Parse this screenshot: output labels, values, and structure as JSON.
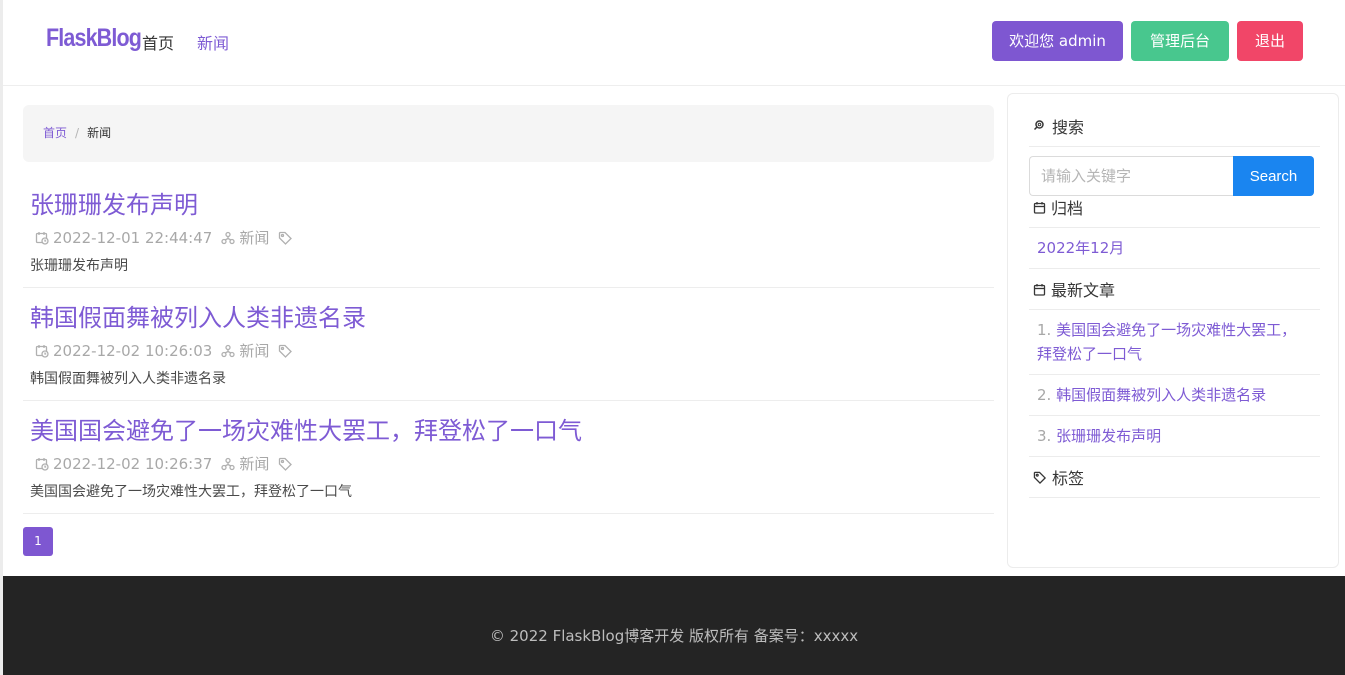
{
  "navbar": {
    "brand": "FlaskBlog",
    "links": [
      {
        "label": "首页"
      },
      {
        "label": "新闻"
      }
    ],
    "buttons": {
      "welcome": "欢迎您 admin",
      "admin": "管理后台",
      "logout": "退出"
    }
  },
  "breadcrumb": {
    "home": "首页",
    "separator": "/",
    "current": "新闻"
  },
  "posts": [
    {
      "title": "张珊珊发布声明",
      "date": "2022-12-01 22:44:47",
      "category": "新闻",
      "summary": "张珊珊发布声明"
    },
    {
      "title": "韩国假面舞被列入人类非遗名录",
      "date": "2022-12-02 10:26:03",
      "category": "新闻",
      "summary": "韩国假面舞被列入人类非遗名录"
    },
    {
      "title": "美国国会避免了一场灾难性大罢工，拜登松了一口气",
      "date": "2022-12-02 10:26:37",
      "category": "新闻",
      "summary": "美国国会避免了一场灾难性大罢工，拜登松了一口气"
    }
  ],
  "pagination": {
    "current_page": "1"
  },
  "sidebar": {
    "search": {
      "heading": "搜索",
      "placeholder": "请输入关键字",
      "button": "Search"
    },
    "archive": {
      "heading": "归档",
      "items": [
        "2022年12月"
      ]
    },
    "latest": {
      "heading": "最新文章",
      "items": [
        {
          "num": "1.",
          "line1": "美国国会避免了一场灾难性大罢工，",
          "line2": "拜登松了一口气"
        },
        {
          "num": "2.",
          "line1": "韩国假面舞被列入人类非遗名录"
        },
        {
          "num": "3.",
          "line1": "张珊珊发布声明"
        }
      ]
    },
    "tags": {
      "heading": "标签"
    }
  },
  "footer": {
    "text": "© 2022 FlaskBlog博客开发 版权所有 备案号：xxxxx"
  },
  "colors": {
    "accent": "#7e5bd4",
    "success": "#48c78e",
    "danger": "#f14668",
    "search_button": "#1a85f0",
    "footer_bg": "#242424"
  }
}
